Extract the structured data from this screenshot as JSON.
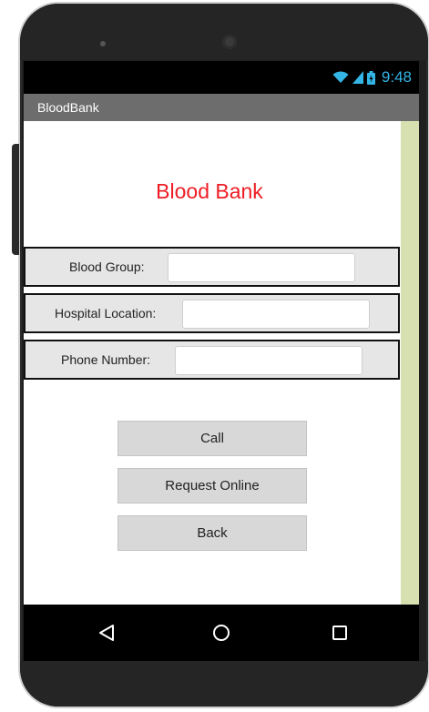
{
  "status_bar": {
    "time": "9:48",
    "icons": [
      "wifi-icon",
      "signal-icon",
      "battery-icon"
    ],
    "color": "#33b5e5"
  },
  "app_title": "BloodBank",
  "heading": "Blood Bank",
  "heading_color": "#ee1c24",
  "form": {
    "blood_group": {
      "label": "Blood Group:",
      "value": ""
    },
    "hospital_location": {
      "label": "Hospital Location:",
      "value": ""
    },
    "phone_number": {
      "label": "Phone Number:",
      "value": ""
    }
  },
  "buttons": {
    "call": "Call",
    "request_online": "Request Online",
    "back": "Back"
  },
  "nav_bar": {
    "icons": [
      "back-triangle-icon",
      "home-circle-icon",
      "recents-square-icon"
    ]
  },
  "colors": {
    "title_bar": "#6d6d6d",
    "row_background": "#e6e6e6",
    "button_background": "#d8d8d8",
    "scroll_strip": "#d6e0b1"
  }
}
